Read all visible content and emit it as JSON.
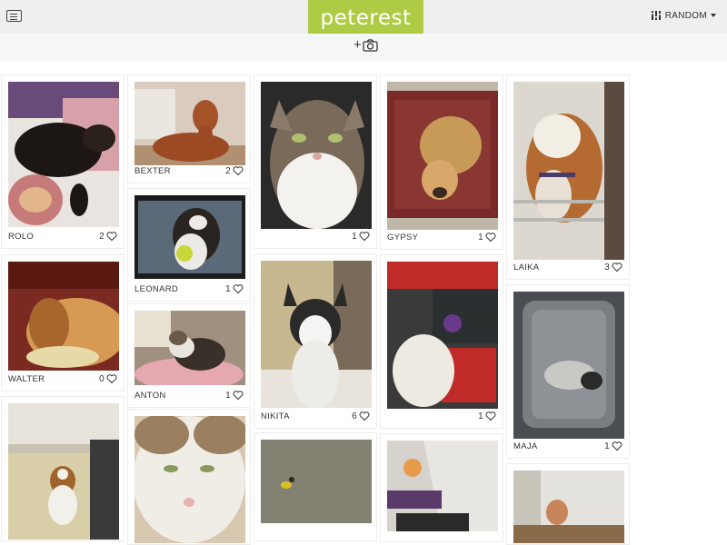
{
  "header": {
    "logo": "peterest",
    "sort_label": "RANDOM",
    "upload_label": "+"
  },
  "colors": {
    "brand": "#aecb45",
    "topbar": "#efefef"
  },
  "icons": {
    "menu": "menu-icon",
    "sort": "sort-grid-icon",
    "dropdown": "caret-down-icon",
    "camera": "camera-icon",
    "like": "heart-icon"
  },
  "pets": [
    {
      "name": "ROLO",
      "likes": "2",
      "photo": "black cat on blanket"
    },
    {
      "name": "BEXTER",
      "likes": "2",
      "photo": "vizsla dog"
    },
    {
      "name": "",
      "likes": "1",
      "photo": "tabby cat"
    },
    {
      "name": "GYPSY",
      "likes": "1",
      "photo": "dog on rug"
    },
    {
      "name": "LAIKA",
      "likes": "3",
      "photo": "horse"
    },
    {
      "name": "LEONARD",
      "likes": "1",
      "photo": "spaniel with ball"
    },
    {
      "name": "WALTER",
      "likes": "0",
      "photo": "sleeping beagle"
    },
    {
      "name": "NIKITA",
      "likes": "6",
      "photo": "husky"
    },
    {
      "name": "ANTON",
      "likes": "1",
      "photo": "cat on towel"
    },
    {
      "name": "",
      "likes": "1",
      "photo": "white dog in cart"
    },
    {
      "name": "MAJA",
      "likes": "1",
      "photo": "pug in car seat"
    },
    {
      "name": "",
      "likes": "",
      "photo": "beagle in kitchen"
    },
    {
      "name": "",
      "likes": "",
      "photo": "cat face close-up"
    },
    {
      "name": "",
      "likes": "",
      "photo": "duck in pond"
    },
    {
      "name": "",
      "likes": "",
      "photo": "toys in room"
    },
    {
      "name": "",
      "likes": "",
      "photo": "poodle indoors"
    }
  ]
}
